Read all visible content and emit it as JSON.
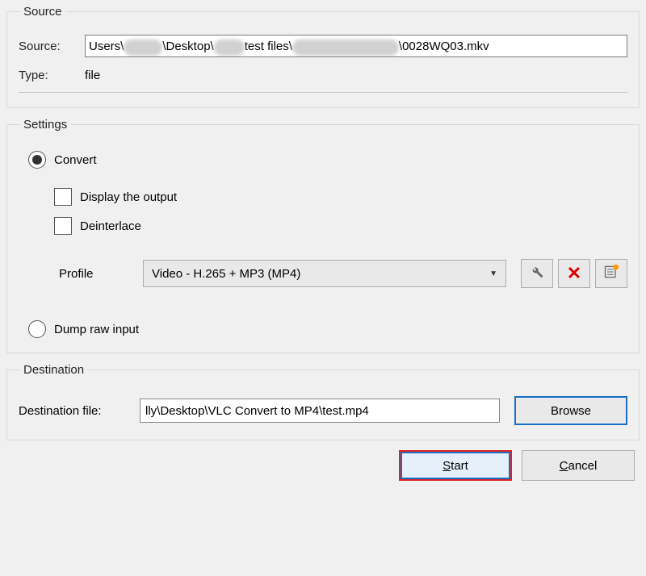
{
  "source": {
    "legend": "Source",
    "label": "Source:",
    "path_seg1": "Users\\",
    "path_seg2": "\\Desktop\\",
    "path_seg3": "test files\\",
    "path_seg4": "\\0028WQ03.mkv",
    "type_label": "Type:",
    "type_value": "file"
  },
  "settings": {
    "legend": "Settings",
    "convert_label": "Convert",
    "convert_selected": true,
    "display_output_label": "Display the output",
    "display_output_checked": false,
    "deinterlace_label": "Deinterlace",
    "deinterlace_checked": false,
    "profile_label": "Profile",
    "profile_value": "Video - H.265 + MP3 (MP4)",
    "dump_label": "Dump raw input",
    "dump_selected": false
  },
  "destination": {
    "legend": "Destination",
    "label": "Destination file:",
    "value": "lly\\Desktop\\VLC Convert to MP4\\test.mp4",
    "browse_label": "Browse"
  },
  "buttons": {
    "start": "Start",
    "cancel": "Cancel"
  }
}
